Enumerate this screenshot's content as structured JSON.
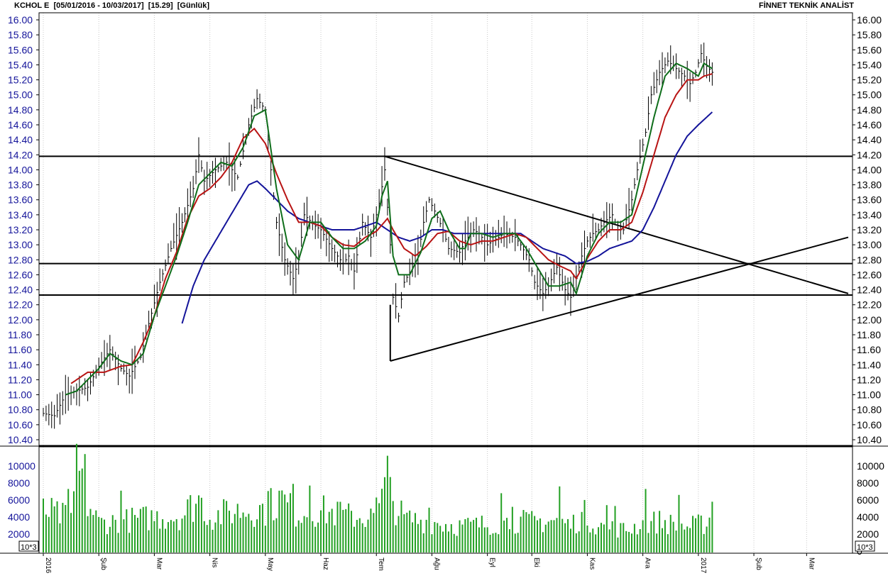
{
  "header": {
    "symbol": "KCHOL E",
    "range": "[05/01/2016 - 10/03/2017]",
    "last": "[15.29]",
    "period": "[Günlük]",
    "brand": "FİNNET TEKNİK ANALİST"
  },
  "chart_data": {
    "type": "line",
    "title": "KCHOL E [05/01/2016 - 10/03/2017] [15.29] [Günlük]",
    "price_axis": {
      "ylim": [
        10.4,
        16.0
      ],
      "ticks": [
        "16.00",
        "15.80",
        "15.60",
        "15.40",
        "15.20",
        "15.00",
        "14.80",
        "14.60",
        "14.40",
        "14.20",
        "14.00",
        "13.80",
        "13.60",
        "13.40",
        "13.20",
        "13.00",
        "12.80",
        "12.60",
        "12.40",
        "12.20",
        "12.00",
        "11.80",
        "11.60",
        "11.40",
        "11.20",
        "11.00",
        "10.80",
        "10.60",
        "10.40"
      ]
    },
    "volume_axis": {
      "ylim": [
        0,
        12000
      ],
      "ticks": [
        "10000",
        "8000",
        "6000",
        "4000",
        "2000"
      ],
      "right_ticks": [
        "10000",
        "8000",
        "6000",
        "4000",
        "2000",
        "0"
      ],
      "unit": "10^3"
    },
    "x_labels": [
      "2016",
      "Şub",
      "Mar",
      "Nis",
      "May",
      "Haz",
      "Tem",
      "Ağu",
      "Eyl",
      "Eki",
      "Kas",
      "Ara",
      "2017",
      "Şub",
      "Mar"
    ],
    "x_label_days": [
      0,
      20,
      40,
      60,
      80,
      100,
      120,
      140,
      160,
      176,
      196,
      216,
      236,
      256,
      275
    ],
    "total_days": 290,
    "price_anchors": [
      [
        0,
        10.75
      ],
      [
        4,
        10.72
      ],
      [
        8,
        11.0
      ],
      [
        12,
        11.05
      ],
      [
        16,
        11.1
      ],
      [
        20,
        11.38
      ],
      [
        24,
        11.6
      ],
      [
        28,
        11.35
      ],
      [
        31,
        11.25
      ],
      [
        35,
        11.5
      ],
      [
        38,
        11.95
      ],
      [
        42,
        12.5
      ],
      [
        46,
        12.95
      ],
      [
        50,
        13.3
      ],
      [
        54,
        13.75
      ],
      [
        56,
        14.2
      ],
      [
        58,
        13.85
      ],
      [
        62,
        14.0
      ],
      [
        66,
        14.1
      ],
      [
        70,
        13.9
      ],
      [
        74,
        14.6
      ],
      [
        77,
        14.95
      ],
      [
        80,
        14.8
      ],
      [
        82,
        14.0
      ],
      [
        84,
        13.3
      ],
      [
        87,
        12.8
      ],
      [
        90,
        12.55
      ],
      [
        92,
        12.8
      ],
      [
        94,
        13.4
      ],
      [
        98,
        13.25
      ],
      [
        100,
        13.2
      ],
      [
        104,
        12.95
      ],
      [
        108,
        12.75
      ],
      [
        110,
        12.85
      ],
      [
        112,
        12.65
      ],
      [
        115,
        13.3
      ],
      [
        118,
        13.1
      ],
      [
        121,
        13.55
      ],
      [
        123,
        14.0
      ],
      [
        125,
        13.0
      ],
      [
        126,
        12.3
      ],
      [
        128,
        12.05
      ],
      [
        130,
        12.5
      ],
      [
        133,
        12.7
      ],
      [
        135,
        12.85
      ],
      [
        137,
        13.3
      ],
      [
        139,
        13.6
      ],
      [
        141,
        13.45
      ],
      [
        144,
        13.2
      ],
      [
        146,
        12.95
      ],
      [
        150,
        12.9
      ],
      [
        152,
        13.05
      ],
      [
        155,
        13.2
      ],
      [
        157,
        13.15
      ],
      [
        160,
        13.0
      ],
      [
        162,
        13.05
      ],
      [
        166,
        13.15
      ],
      [
        170,
        13.1
      ],
      [
        172,
        13.0
      ],
      [
        175,
        12.8
      ],
      [
        177,
        12.5
      ],
      [
        180,
        12.35
      ],
      [
        182,
        12.45
      ],
      [
        185,
        12.7
      ],
      [
        188,
        12.4
      ],
      [
        190,
        12.3
      ],
      [
        192,
        12.55
      ],
      [
        194,
        12.85
      ],
      [
        196,
        13.05
      ],
      [
        198,
        13.15
      ],
      [
        200,
        13.2
      ],
      [
        202,
        13.3
      ],
      [
        205,
        13.4
      ],
      [
        207,
        13.2
      ],
      [
        209,
        13.2
      ],
      [
        212,
        13.6
      ],
      [
        214,
        14.0
      ],
      [
        217,
        14.5
      ],
      [
        219,
        15.0
      ],
      [
        222,
        15.3
      ],
      [
        225,
        15.45
      ],
      [
        228,
        15.35
      ],
      [
        231,
        15.25
      ],
      [
        233,
        15.15
      ],
      [
        235,
        15.3
      ],
      [
        237,
        15.55
      ],
      [
        239,
        15.38
      ],
      [
        241,
        15.3
      ]
    ],
    "sma_fast_anchors": [
      [
        8,
        11.0
      ],
      [
        12,
        11.05
      ],
      [
        20,
        11.35
      ],
      [
        24,
        11.55
      ],
      [
        28,
        11.45
      ],
      [
        32,
        11.4
      ],
      [
        36,
        11.55
      ],
      [
        40,
        12.05
      ],
      [
        44,
        12.45
      ],
      [
        48,
        12.85
      ],
      [
        52,
        13.3
      ],
      [
        56,
        13.8
      ],
      [
        60,
        13.95
      ],
      [
        64,
        14.1
      ],
      [
        68,
        14.05
      ],
      [
        72,
        14.3
      ],
      [
        76,
        14.72
      ],
      [
        80,
        14.8
      ],
      [
        84,
        13.75
      ],
      [
        88,
        13.0
      ],
      [
        92,
        12.8
      ],
      [
        96,
        13.3
      ],
      [
        100,
        13.3
      ],
      [
        104,
        13.1
      ],
      [
        108,
        12.95
      ],
      [
        112,
        12.95
      ],
      [
        116,
        13.05
      ],
      [
        120,
        13.25
      ],
      [
        122,
        13.65
      ],
      [
        124,
        13.85
      ],
      [
        126,
        12.85
      ],
      [
        128,
        12.6
      ],
      [
        132,
        12.6
      ],
      [
        136,
        12.9
      ],
      [
        140,
        13.35
      ],
      [
        143,
        13.45
      ],
      [
        146,
        13.2
      ],
      [
        150,
        12.95
      ],
      [
        152,
        12.95
      ],
      [
        154,
        13.15
      ],
      [
        158,
        13.15
      ],
      [
        162,
        13.1
      ],
      [
        166,
        13.15
      ],
      [
        170,
        13.15
      ],
      [
        174,
        12.95
      ],
      [
        178,
        12.7
      ],
      [
        182,
        12.45
      ],
      [
        186,
        12.45
      ],
      [
        190,
        12.5
      ],
      [
        192,
        12.35
      ],
      [
        196,
        12.85
      ],
      [
        200,
        13.15
      ],
      [
        204,
        13.3
      ],
      [
        208,
        13.3
      ],
      [
        212,
        13.4
      ],
      [
        216,
        14.05
      ],
      [
        220,
        14.7
      ],
      [
        224,
        15.25
      ],
      [
        228,
        15.42
      ],
      [
        232,
        15.35
      ],
      [
        236,
        15.25
      ],
      [
        238,
        15.42
      ],
      [
        241,
        15.35
      ]
    ],
    "sma_mid_anchors": [
      [
        10,
        11.15
      ],
      [
        16,
        11.3
      ],
      [
        22,
        11.3
      ],
      [
        28,
        11.38
      ],
      [
        32,
        11.4
      ],
      [
        36,
        11.7
      ],
      [
        40,
        12.05
      ],
      [
        44,
        12.55
      ],
      [
        48,
        12.9
      ],
      [
        52,
        13.35
      ],
      [
        56,
        13.65
      ],
      [
        60,
        13.75
      ],
      [
        64,
        13.9
      ],
      [
        68,
        14.1
      ],
      [
        72,
        14.42
      ],
      [
        76,
        14.55
      ],
      [
        80,
        14.35
      ],
      [
        84,
        13.95
      ],
      [
        88,
        13.6
      ],
      [
        92,
        13.3
      ],
      [
        96,
        13.3
      ],
      [
        100,
        13.25
      ],
      [
        104,
        13.1
      ],
      [
        108,
        13.0
      ],
      [
        112,
        12.98
      ],
      [
        116,
        13.1
      ],
      [
        120,
        13.18
      ],
      [
        124,
        13.35
      ],
      [
        126,
        13.2
      ],
      [
        130,
        12.95
      ],
      [
        134,
        12.85
      ],
      [
        138,
        12.98
      ],
      [
        142,
        13.15
      ],
      [
        146,
        13.18
      ],
      [
        150,
        13.05
      ],
      [
        154,
        13.0
      ],
      [
        158,
        13.05
      ],
      [
        162,
        13.05
      ],
      [
        166,
        13.1
      ],
      [
        170,
        13.15
      ],
      [
        174,
        13.1
      ],
      [
        178,
        12.95
      ],
      [
        182,
        12.8
      ],
      [
        186,
        12.72
      ],
      [
        190,
        12.65
      ],
      [
        192,
        12.55
      ],
      [
        196,
        12.82
      ],
      [
        200,
        13.05
      ],
      [
        204,
        13.2
      ],
      [
        208,
        13.2
      ],
      [
        212,
        13.3
      ],
      [
        216,
        13.7
      ],
      [
        220,
        14.2
      ],
      [
        224,
        14.7
      ],
      [
        228,
        15.0
      ],
      [
        232,
        15.2
      ],
      [
        236,
        15.2
      ],
      [
        238,
        15.25
      ],
      [
        241,
        15.28
      ]
    ],
    "sma_slow_anchors": [
      [
        50,
        11.95
      ],
      [
        54,
        12.45
      ],
      [
        58,
        12.8
      ],
      [
        62,
        13.05
      ],
      [
        66,
        13.3
      ],
      [
        70,
        13.55
      ],
      [
        74,
        13.8
      ],
      [
        77,
        13.85
      ],
      [
        80,
        13.75
      ],
      [
        84,
        13.6
      ],
      [
        88,
        13.45
      ],
      [
        92,
        13.35
      ],
      [
        96,
        13.3
      ],
      [
        100,
        13.25
      ],
      [
        104,
        13.2
      ],
      [
        108,
        13.2
      ],
      [
        112,
        13.2
      ],
      [
        116,
        13.25
      ],
      [
        120,
        13.3
      ],
      [
        124,
        13.2
      ],
      [
        128,
        13.1
      ],
      [
        132,
        13.05
      ],
      [
        136,
        13.1
      ],
      [
        140,
        13.2
      ],
      [
        144,
        13.2
      ],
      [
        148,
        13.15
      ],
      [
        152,
        13.15
      ],
      [
        156,
        13.15
      ],
      [
        160,
        13.15
      ],
      [
        164,
        13.15
      ],
      [
        168,
        13.15
      ],
      [
        172,
        13.15
      ],
      [
        176,
        13.05
      ],
      [
        180,
        12.95
      ],
      [
        184,
        12.9
      ],
      [
        188,
        12.85
      ],
      [
        192,
        12.75
      ],
      [
        196,
        12.78
      ],
      [
        200,
        12.85
      ],
      [
        204,
        12.95
      ],
      [
        208,
        13.0
      ],
      [
        212,
        13.05
      ],
      [
        216,
        13.2
      ],
      [
        220,
        13.5
      ],
      [
        224,
        13.85
      ],
      [
        228,
        14.2
      ],
      [
        232,
        14.45
      ],
      [
        236,
        14.6
      ],
      [
        241,
        14.77
      ]
    ],
    "horizontal_levels": [
      14.18,
      12.75,
      12.33
    ],
    "trend_lines": [
      {
        "from": [
          123,
          14.18
        ],
        "to": [
          290,
          12.35
        ]
      },
      {
        "from": [
          125,
          11.45
        ],
        "to": [
          290,
          13.1
        ]
      },
      {
        "from": [
          125,
          11.45
        ],
        "to": [
          125,
          12.2
        ]
      }
    ],
    "volume_profile": [
      [
        0,
        5000
      ],
      [
        10,
        4000
      ],
      [
        12,
        10000
      ],
      [
        15,
        6500
      ],
      [
        20,
        3500
      ],
      [
        30,
        3800
      ],
      [
        40,
        4200
      ],
      [
        50,
        4400
      ],
      [
        56,
        6500
      ],
      [
        60,
        4200
      ],
      [
        70,
        5000
      ],
      [
        80,
        5200
      ],
      [
        86,
        6500
      ],
      [
        90,
        4800
      ],
      [
        100,
        5000
      ],
      [
        110,
        4300
      ],
      [
        120,
        4200
      ],
      [
        124,
        8000
      ],
      [
        126,
        6000
      ],
      [
        130,
        4000
      ],
      [
        140,
        3600
      ],
      [
        150,
        3100
      ],
      [
        160,
        3300
      ],
      [
        170,
        3700
      ],
      [
        176,
        3600
      ],
      [
        185,
        3800
      ],
      [
        190,
        3200
      ],
      [
        195,
        4500
      ],
      [
        200,
        3100
      ],
      [
        210,
        2600
      ],
      [
        215,
        3300
      ],
      [
        222,
        3700
      ],
      [
        228,
        3200
      ],
      [
        232,
        3000
      ],
      [
        238,
        3400
      ],
      [
        241,
        4500
      ]
    ],
    "volume_spikes": [
      [
        12,
        12600
      ],
      [
        15,
        11400
      ],
      [
        124,
        11200
      ],
      [
        125,
        8700
      ],
      [
        9,
        7300
      ],
      [
        28,
        7100
      ],
      [
        82,
        7400
      ],
      [
        90,
        7900
      ],
      [
        96,
        7700
      ],
      [
        106,
        5800
      ],
      [
        120,
        6300
      ],
      [
        139,
        5100
      ],
      [
        165,
        6800
      ],
      [
        186,
        7600
      ],
      [
        206,
        5300
      ],
      [
        217,
        7300
      ],
      [
        229,
        6600
      ],
      [
        241,
        5800
      ],
      [
        169,
        5200
      ],
      [
        203,
        5400
      ]
    ],
    "series": [
      {
        "name": "",
        "color": "#000000"
      },
      {
        "name": "",
        "color": "#0f6e1b"
      },
      {
        "name": "",
        "color": "#b81414"
      },
      {
        "name": "",
        "color": "#14149a"
      }
    ]
  }
}
